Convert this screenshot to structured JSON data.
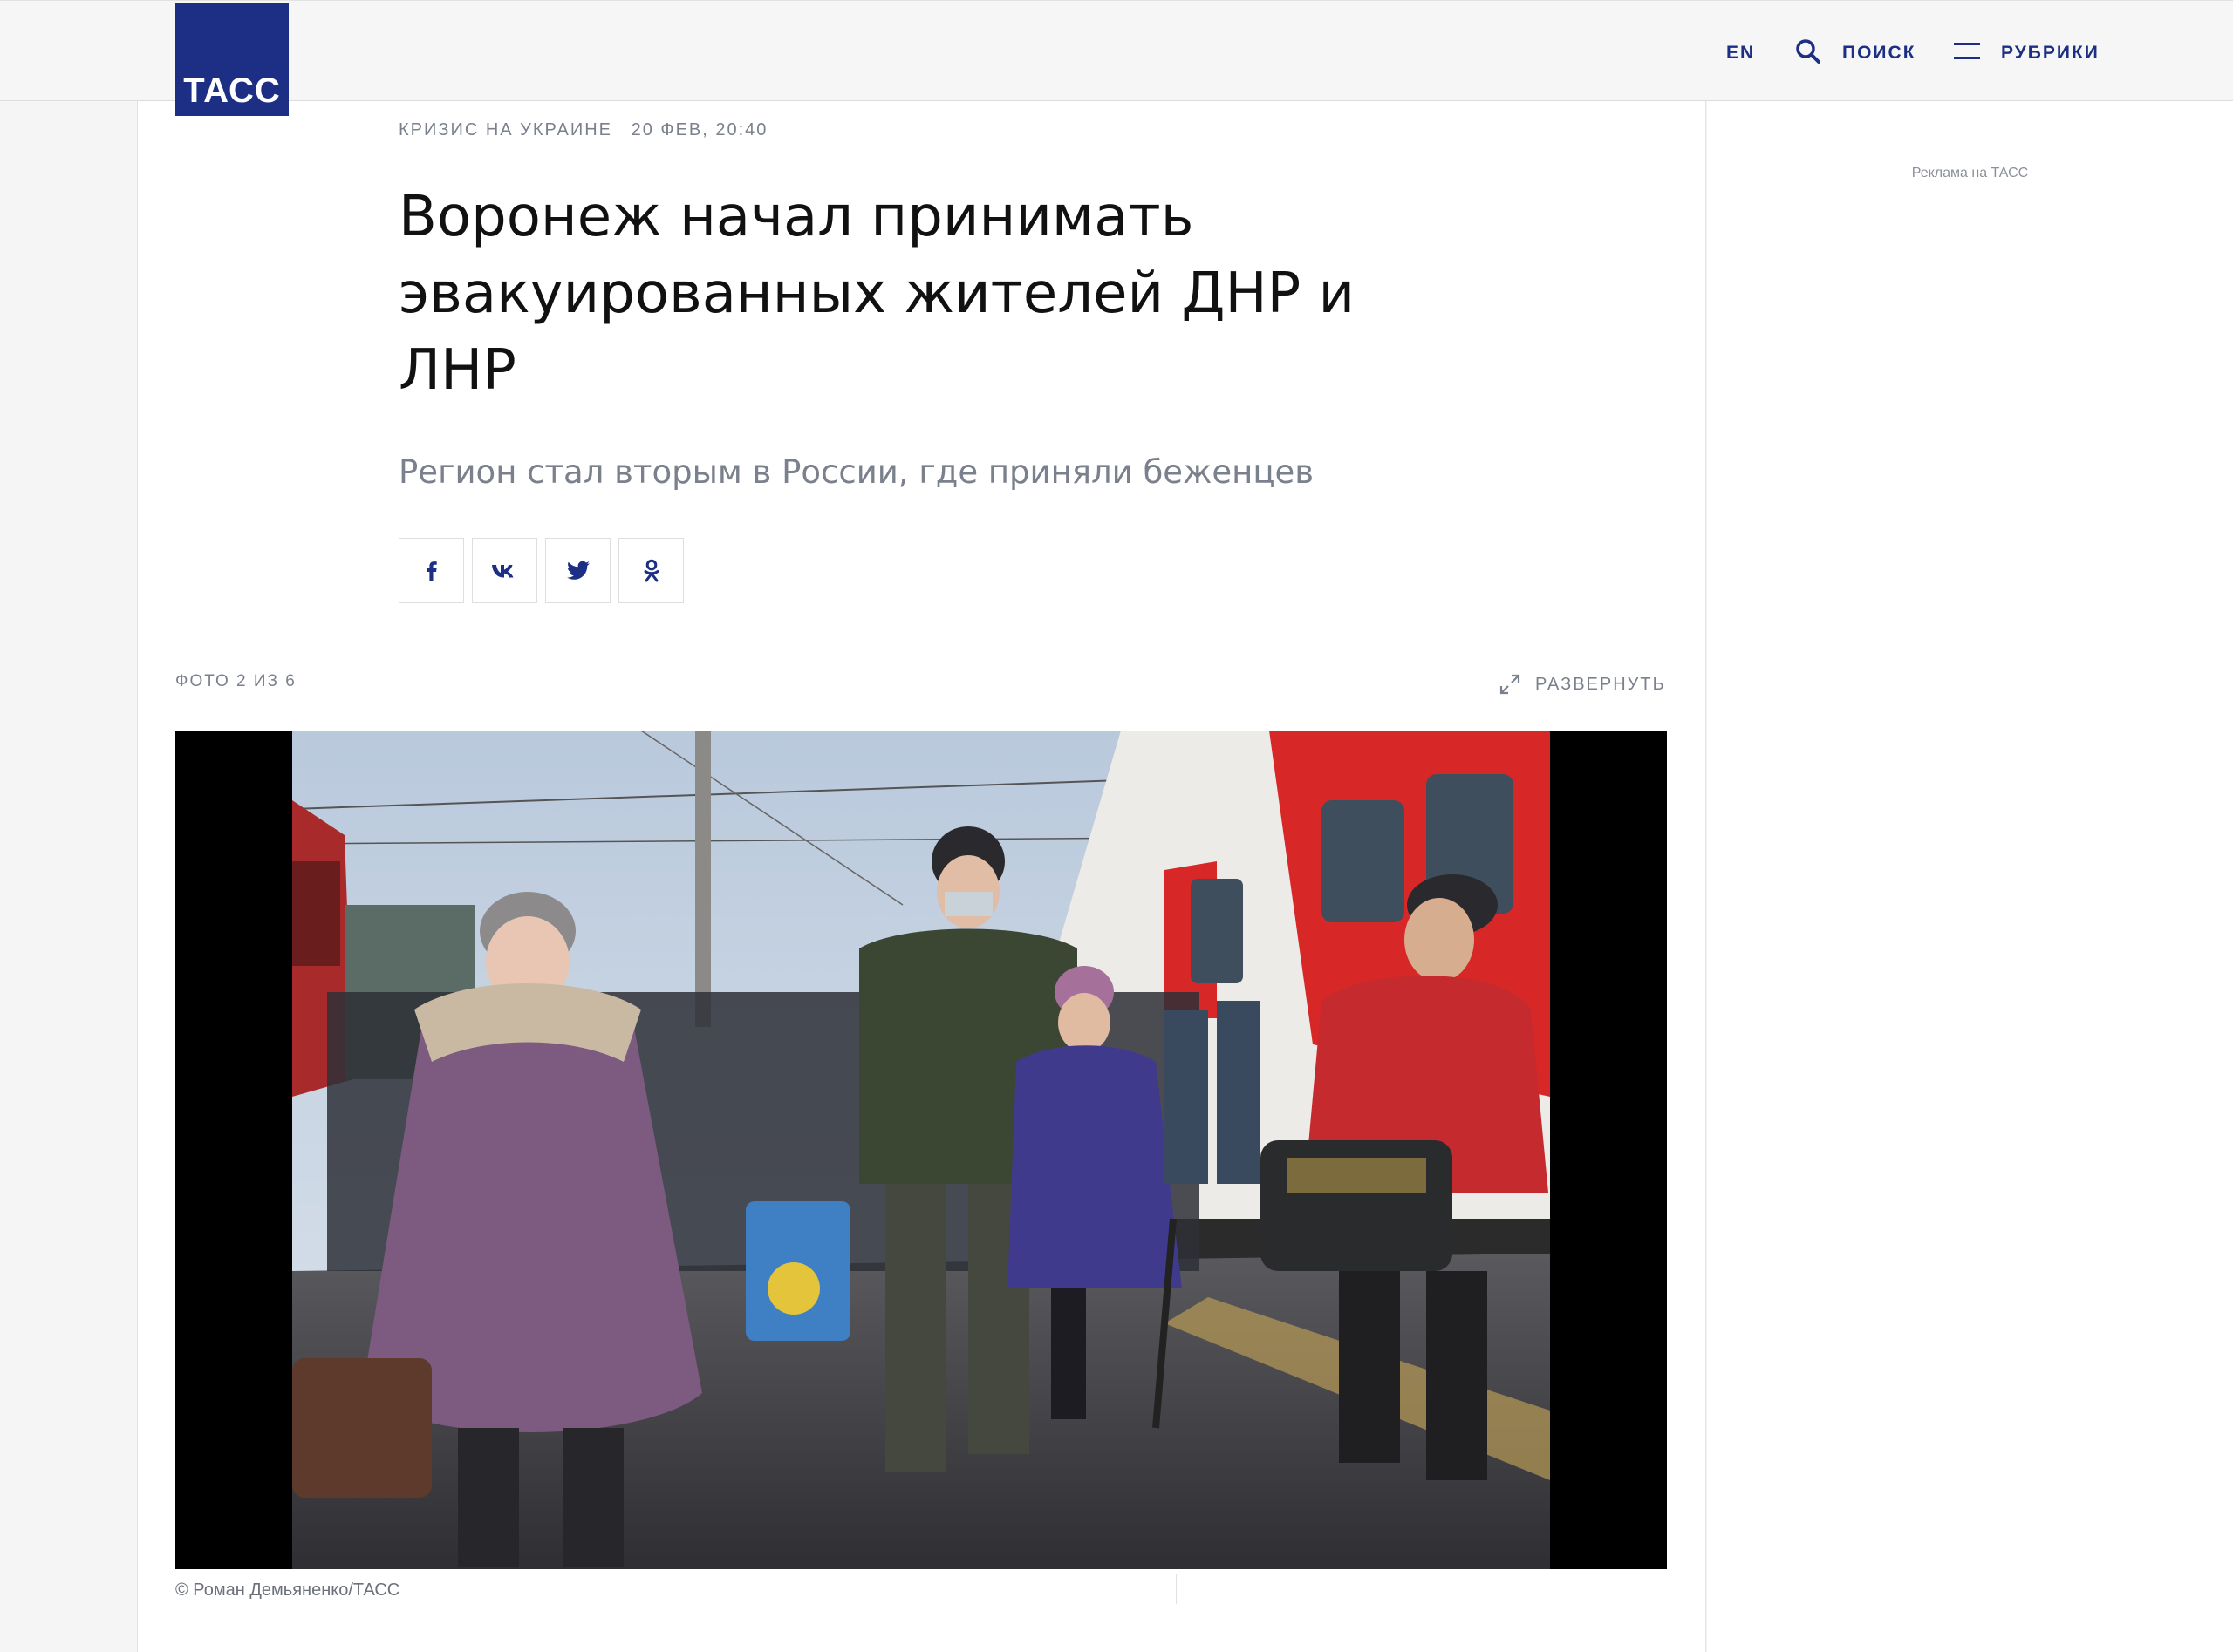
{
  "header": {
    "logo_text": "ТАСС",
    "lang_label": "EN",
    "search_label": "ПОИСК",
    "menu_label": "РУБРИКИ",
    "brand_color": "#1c2f84"
  },
  "article": {
    "rubric": "Кризис на Украине",
    "date": "20 ФЕВ, 20:40",
    "title": "Воронеж начал принимать эвакуированных жителей ДНР и ЛНР",
    "subtitle": "Регион стал вторым в России, где приняли беженцев"
  },
  "share": [
    {
      "name": "facebook",
      "icon": "facebook-icon"
    },
    {
      "name": "vk",
      "icon": "vk-icon"
    },
    {
      "name": "twitter",
      "icon": "twitter-icon"
    },
    {
      "name": "odnoklassniki",
      "icon": "odnoklassniki-icon"
    }
  ],
  "gallery": {
    "counter": "ФОТО 2 ИЗ 6",
    "expand_label": "РАЗВЕРНУТЬ",
    "credit": "© Роман Демьяненко/ТАСС"
  },
  "sidebar": {
    "ad_label": "Реклама на ТАСС"
  }
}
